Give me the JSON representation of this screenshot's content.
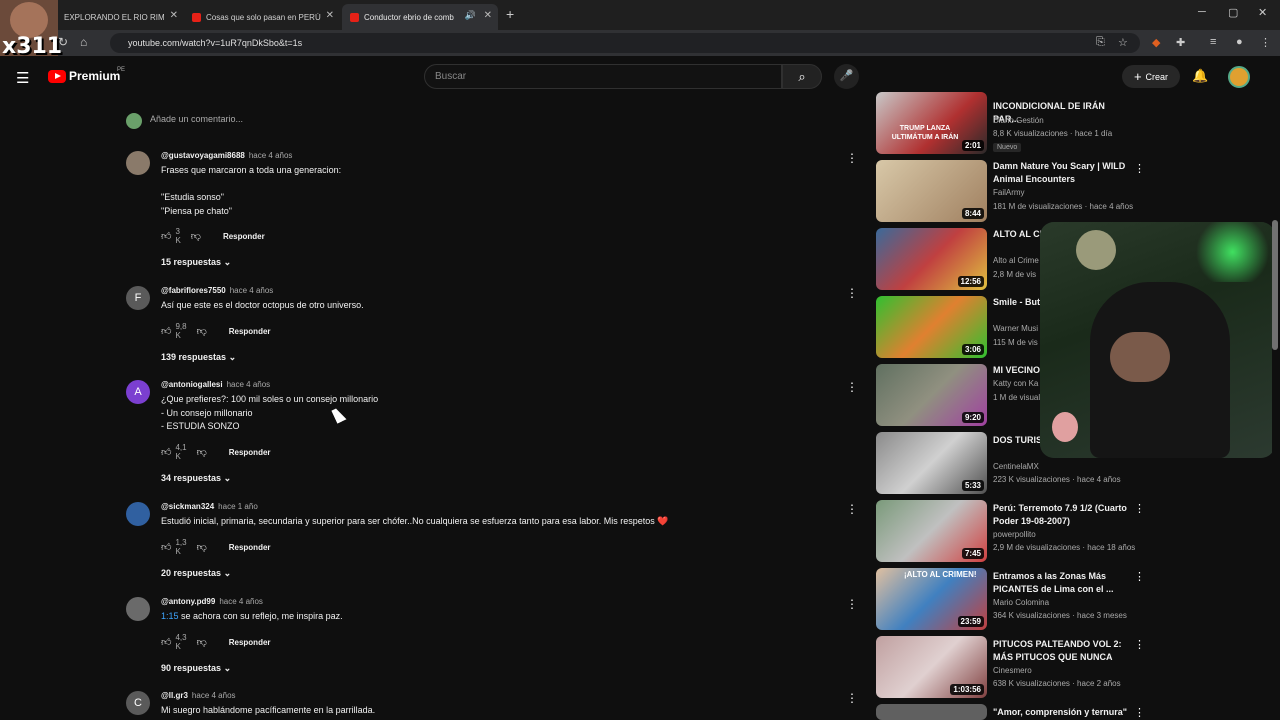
{
  "browser": {
    "tabs": [
      {
        "label": "EXPLORANDO EL RIO RIMA"
      },
      {
        "label": "Cosas que solo pasan en PERÚ"
      },
      {
        "label": "Conductor ebrio de comb"
      }
    ],
    "url": "youtube.com/watch?v=1uR7qnDkSbo&t=1s"
  },
  "overlay": {
    "logo_text": "x311"
  },
  "youtube": {
    "brand": "Premium",
    "region": "PE",
    "search_placeholder": "Buscar",
    "create_label": "Crear"
  },
  "comments_section": {
    "add_comment_placeholder": "Añade un comentario...",
    "reply_label": "Responder",
    "comments": [
      {
        "avatar_letter": "",
        "avatar_color": "#8a7a6a",
        "user": "@gustavoyagami8688",
        "time": "hace 4 años",
        "text": "Frases que marcaron a toda una generacion:\n\n\"Estudia sonso\"\n\"Piensa pe chato\"",
        "likes": "3 K",
        "replies": "15 respuestas"
      },
      {
        "avatar_letter": "F",
        "avatar_color": "#5a5a5a",
        "user": "@fabriflores7550",
        "time": "hace 4 años",
        "text": "Así que este es el doctor octopus de otro universo.",
        "likes": "9,8 K",
        "replies": "139 respuestas"
      },
      {
        "avatar_letter": "A",
        "avatar_color": "#7b3fd0",
        "user": "@antoniogallesi",
        "time": "hace 4 años",
        "text": "¿Que prefieres?: 100 mil soles o un consejo millonario\n- Un consejo millonario\n- ESTUDIA SONZO",
        "likes": "4,1 K",
        "replies": "34 respuestas"
      },
      {
        "avatar_letter": "",
        "avatar_color": "#3060a0",
        "user": "@sickman324",
        "time": "hace 1 año",
        "text": "Estudió inicial, primaria, secundaria y superior para ser chófer..No cualquiera se esfuerza tanto para esa labor. Mis respetos ❤️",
        "likes": "1,3 K",
        "replies": "20 respuestas"
      },
      {
        "avatar_letter": "",
        "avatar_color": "#6a6a6a",
        "user": "@antony.pd99",
        "time": "hace 4 años",
        "timestamp": "1:15",
        "text": "se achora con su reflejo, me inspira paz.",
        "likes": "4,3 K",
        "replies": "90 respuestas"
      },
      {
        "avatar_letter": "C",
        "avatar_color": "#5a5a5a",
        "user": "@ll.gr3",
        "time": "hace 4 años",
        "text": "Mi suegro hablándome pacíficamente en la parrillada.",
        "likes": "",
        "replies": ""
      }
    ]
  },
  "sidebar": {
    "videos": [
      {
        "title": "INCONDICIONAL DE IRÁN PAR...",
        "thumb_text": "TRUMP LANZA ULTIMÁTUM A IRÁN",
        "duration": "2:01",
        "channel": "Diario Gestión",
        "meta": "8,8 K visualizaciones · hace 1 día",
        "badge": "Nuevo"
      },
      {
        "title": "Damn Nature You Scary | WILD Animal Encounters",
        "duration": "8:44",
        "channel": "FailArmy",
        "meta": "181 M de visualizaciones · hace 4 años"
      },
      {
        "title": "ALTO AL CRIM \"LA IRA DEL",
        "duration": "12:56",
        "channel": "Alto al Crime",
        "meta": "2,8 M de vis"
      },
      {
        "title": "Smile - But Video)",
        "duration": "3:06",
        "channel": "Warner Musi",
        "meta": "115 M de vis"
      },
      {
        "title": "MI VECINO",
        "duration": "9:20",
        "channel": "Katty con Ka",
        "meta": "1 M de visual"
      },
      {
        "title": "DOS TURISTA estadounidens",
        "duration": "5:33",
        "channel": "CentinelaMX",
        "meta": "223 K visualizaciones · hace 4 años"
      },
      {
        "title": "Perú: Terremoto 7.9 1/2 (Cuarto Poder 19-08-2007)",
        "duration": "7:45",
        "channel": "powerpollito",
        "meta": "2,9 M de visualizaciones · hace 18 años"
      },
      {
        "title": "Entramos a las Zonas Más PICANTES de Lima con el ...",
        "thumb_text": "¡ALTO AL CRIMEN!",
        "duration": "23:59",
        "channel": "Mario Colomina",
        "meta": "364 K visualizaciones · hace 3 meses"
      },
      {
        "title": "PITUCOS PALTEANDO VOL 2: MÁS PITUCOS QUE NUNCA",
        "duration": "1:03:56",
        "channel": "Cinesmero",
        "meta": "638 K visualizaciones · hace 2 años"
      },
      {
        "title": "\"Amor, comprensión y ternura\"",
        "duration": "",
        "channel": "",
        "meta": ""
      }
    ]
  },
  "colors": {
    "bg": "#0f0f0f",
    "link": "#3ea6ff",
    "youtube_red": "#ff0000"
  }
}
